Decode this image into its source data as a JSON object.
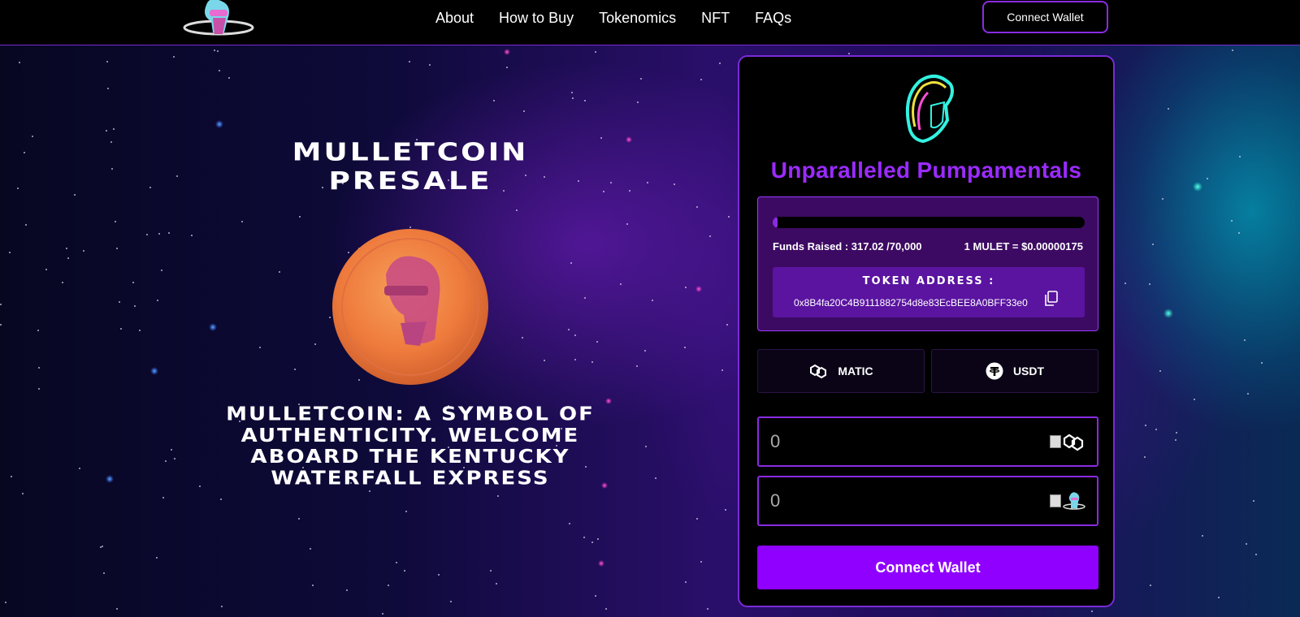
{
  "header": {
    "nav": [
      "About",
      "How to Buy",
      "Tokenomics",
      "NFT",
      "FAQs"
    ],
    "connect_label": "Connect Wallet"
  },
  "hero": {
    "title_line1": "MULLETCOIN",
    "title_line2": "PRESALE",
    "subtitle_lines": [
      "MULLETCOIN: A SYMBOL OF",
      "AUTHENTICITY. WELCOME",
      "ABOARD THE KENTUCKY",
      "WATERFALL EXPRESS"
    ]
  },
  "presale": {
    "title": "Unparalleled Pumpamentals",
    "progress_fraction": 0.0045,
    "funds_raised": "Funds Raised : 317.02 /70,000",
    "rate": "1 MULET = $0.00000175",
    "token_address_label": "TOKEN ADDRESS :",
    "token_address": "0x8B4fa20C4B9111882754d8e83EcBEE8A0BFF33e0",
    "currencies": [
      {
        "label": "MATIC",
        "icon": "polygon-icon"
      },
      {
        "label": "USDT",
        "icon": "tether-icon"
      }
    ],
    "amount_pay": "0",
    "amount_receive": "0",
    "connect_label": "Connect Wallet"
  },
  "colors": {
    "accent": "#8f00ff",
    "title_purple": "#9b2bff",
    "border_purple": "#7a2bd6"
  }
}
